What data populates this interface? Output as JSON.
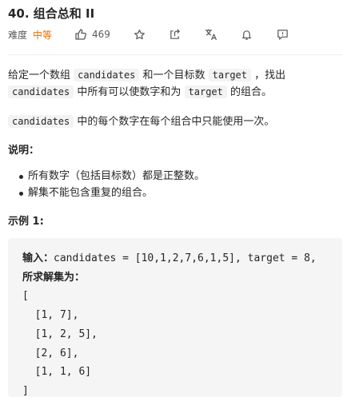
{
  "problem": {
    "title": "40. 组合总和 II",
    "difficulty_label": "难度",
    "difficulty": "中等",
    "likes": "469"
  },
  "toolbar": {
    "icons": [
      "thumbs-up-icon",
      "star-icon",
      "share-icon",
      "translate-icon",
      "bell-icon",
      "feedback-icon"
    ]
  },
  "description": {
    "p1_a": "给定一个数组 ",
    "p1_code1": "candidates",
    "p1_b": " 和一个目标数 ",
    "p1_code2": "target",
    "p1_c": " ，找出 ",
    "p1_code3": "candidates",
    "p1_d": " 中所有可以使数字和为 ",
    "p1_code4": "target",
    "p1_e": " 的组合。",
    "p2_code": "candidates",
    "p2_text": " 中的每个数字在每个组合中只能使用一次。"
  },
  "note": {
    "title": "说明：",
    "items": [
      "所有数字（包括目标数）都是正整数。",
      "解集不能包含重复的组合。"
    ]
  },
  "example": {
    "title": "示例 1:",
    "input_label": "输入：",
    "input_value": "candidates = [10,1,2,7,6,1,5], target = 8,",
    "output_label": "所求解集为：",
    "lines": [
      "[",
      "  [1, 7],",
      "  [1, 2, 5],",
      "  [2, 6],",
      "  [1, 1, 6]",
      "]"
    ]
  },
  "colors": {
    "difficulty_medium": "#ef6c00",
    "code_bg": "#f3f3f3",
    "example_bg": "#f5f5f5"
  }
}
